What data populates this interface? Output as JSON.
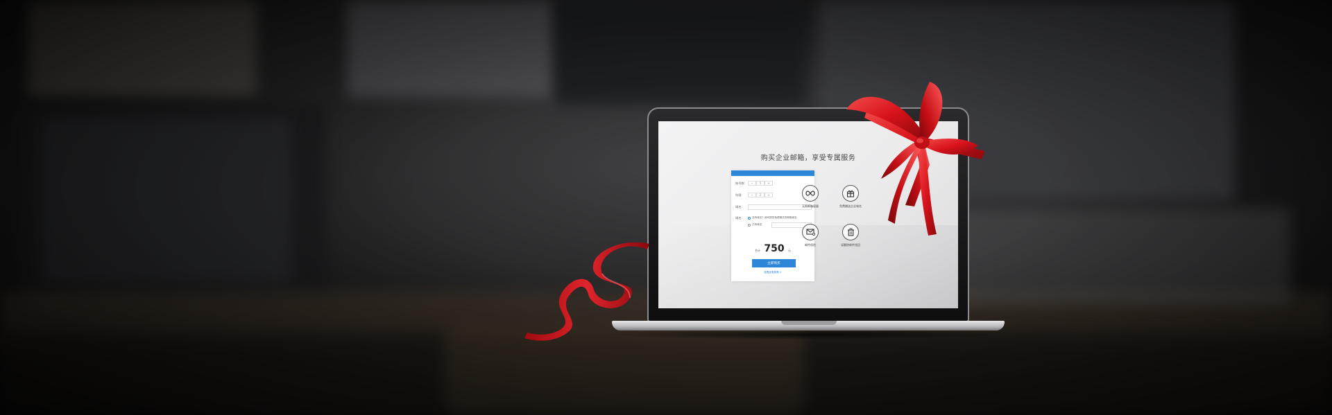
{
  "screen": {
    "headline": "购买企业邮箱，享受专属服务",
    "form": {
      "users_label": "账号数:",
      "users_value": "5",
      "years_label": "年限:",
      "years_value": "2",
      "domain_label": "域名:",
      "mailbox_label": "域名:",
      "radio_new_label": "没有域名？我司提供免费赠送的邮箱域名",
      "radio_own_label": "已有域名",
      "minus": "−",
      "plus": "+",
      "price_prefix": "合计",
      "price_value": "750",
      "price_suffix": "元",
      "buy_label": "立即购买",
      "help_link": "查看优惠政策 >"
    },
    "features": [
      {
        "icon": "infinity-icon",
        "label": "无限邮箱容量"
      },
      {
        "icon": "gift-icon",
        "label": "免费赠送企业域名"
      },
      {
        "icon": "mail-check-icon",
        "label": "邮件保险"
      },
      {
        "icon": "trash-icon",
        "label": "误删除邮件找回"
      }
    ]
  },
  "colors": {
    "accent": "#2d86d7",
    "ribbon": "#d8121a"
  }
}
